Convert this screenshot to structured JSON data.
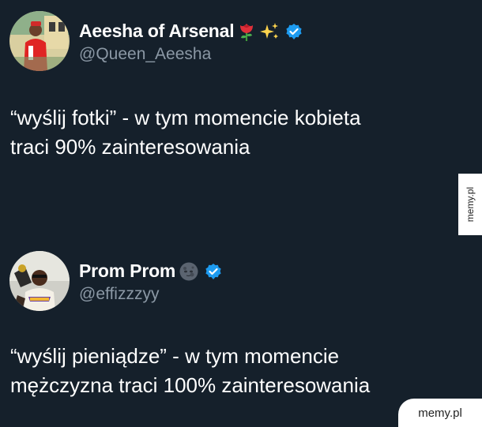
{
  "tweets": [
    {
      "display_name": "Aeesha of Arsenal",
      "handle": "@Queen_Aeesha",
      "text_line1": "“wyślij fotki” - w tym momencie kobieta",
      "text_line2": "traci 90% zainteresowania",
      "emojis": [
        "rose-emoji",
        "sparkles-emoji"
      ],
      "verified": true,
      "avatar": "profile-photo-woman-red-jersey"
    },
    {
      "display_name": "Prom Prom",
      "handle": "@effizzzyy",
      "text_line1": "“wyślij pieniądze” - w tym momencie",
      "text_line2": "mężczyzna traci 100% zainteresowania",
      "emojis": [
        "new-moon-face-emoji"
      ],
      "verified": true,
      "avatar": "profile-photo-man-lakers-jersey"
    }
  ],
  "watermark": {
    "side": "memy.pl",
    "corner": "memy.pl"
  },
  "colors": {
    "background": "#15202b",
    "text": "#ffffff",
    "handle": "#8b98a5",
    "verified": "#1d9bf0"
  }
}
